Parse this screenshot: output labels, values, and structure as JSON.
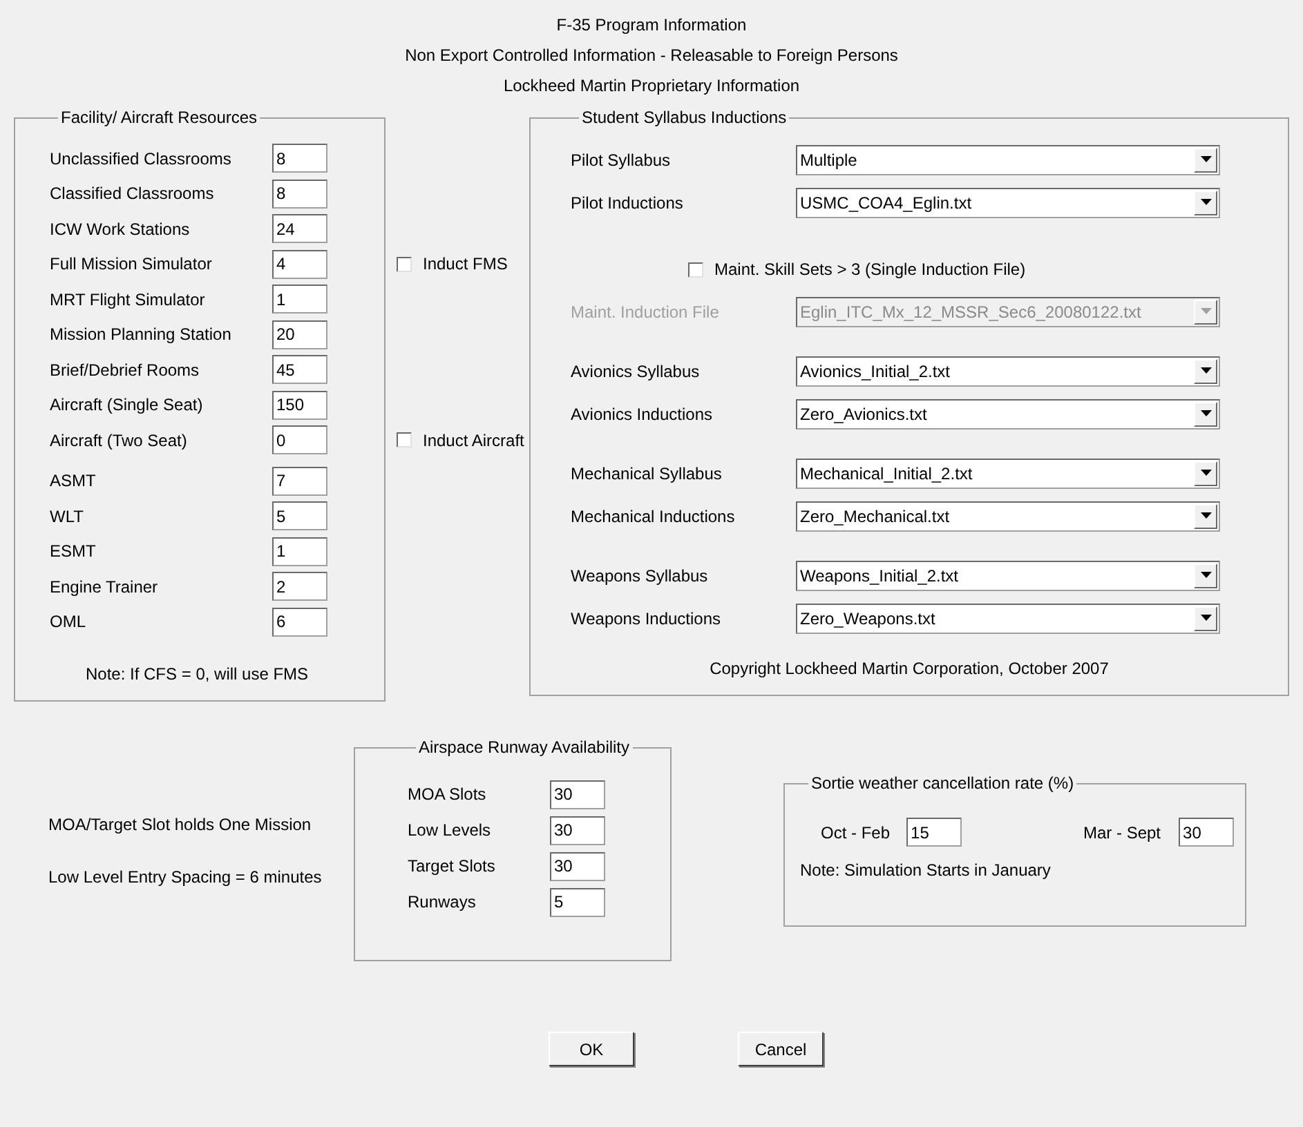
{
  "header": [
    "F-35 Program Information",
    "Non Export Controlled Information - Releasable to Foreign Persons",
    "Lockheed Martin Proprietary Information"
  ],
  "resources": {
    "title": "Facility/ Aircraft Resources",
    "groups": [
      [
        {
          "label": "Unclassified Classrooms",
          "value": "8"
        },
        {
          "label": "Classified Classrooms",
          "value": "8"
        },
        {
          "label": "ICW Work Stations",
          "value": "24"
        },
        {
          "label": "Full Mission Simulator",
          "value": "4",
          "induct": {
            "label": "Induct FMS",
            "checked": false
          }
        },
        {
          "label": "MRT Flight Simulator",
          "value": "1"
        },
        {
          "label": "Mission Planning Station",
          "value": "20"
        },
        {
          "label": "Brief/Debrief Rooms",
          "value": "45"
        },
        {
          "label": "Aircraft (Single Seat)",
          "value": "150"
        },
        {
          "label": "Aircraft (Two Seat)",
          "value": "0",
          "induct": {
            "label": "Induct Aircraft",
            "checked": false
          }
        }
      ],
      [
        {
          "label": "ASMT",
          "value": "7"
        },
        {
          "label": "WLT",
          "value": "5"
        },
        {
          "label": "ESMT",
          "value": "1"
        },
        {
          "label": "Engine Trainer",
          "value": "2"
        },
        {
          "label": "OML",
          "value": "6"
        }
      ]
    ],
    "note": "Note:  If CFS = 0, will use FMS"
  },
  "syllabus": {
    "title": "Student Syllabus  Inductions",
    "groups": [
      [
        {
          "kind": "dropdown",
          "label": "Pilot Syllabus",
          "value": "Multiple",
          "disabled": false
        },
        {
          "kind": "dropdown",
          "label": "Pilot Inductions",
          "value": "USMC_COA4_Eglin.txt",
          "disabled": false
        }
      ],
      [
        {
          "kind": "checkbox",
          "label": "Maint. Skill Sets > 3 (Single Induction File)",
          "checked": false
        },
        {
          "kind": "dropdown",
          "label": "Maint. Induction File",
          "value": "Eglin_ITC_Mx_12_MSSR_Sec6_20080122.txt",
          "disabled": true
        }
      ],
      [
        {
          "kind": "dropdown",
          "label": "Avionics Syllabus",
          "value": "Avionics_Initial_2.txt",
          "disabled": false
        },
        {
          "kind": "dropdown",
          "label": "Avionics Inductions",
          "value": "Zero_Avionics.txt",
          "disabled": false
        }
      ],
      [
        {
          "kind": "dropdown",
          "label": "Mechanical Syllabus",
          "value": "Mechanical_Initial_2.txt",
          "disabled": false
        },
        {
          "kind": "dropdown",
          "label": "Mechanical Inductions",
          "value": "Zero_Mechanical.txt",
          "disabled": false
        }
      ],
      [
        {
          "kind": "dropdown",
          "label": "Weapons Syllabus",
          "value": "Weapons_Initial_2.txt",
          "disabled": false
        },
        {
          "kind": "dropdown",
          "label": "Weapons Inductions",
          "value": "Zero_Weapons.txt",
          "disabled": false
        }
      ]
    ],
    "copyright": "Copyright Lockheed Martin Corporation, October 2007"
  },
  "notes": [
    "MOA/Target Slot holds One Mission",
    "Low Level Entry Spacing = 6 minutes"
  ],
  "airspace": {
    "title": "Airspace  Runway Availability",
    "fields": [
      {
        "label": "MOA Slots",
        "value": "30"
      },
      {
        "label": "Low Levels",
        "value": "30"
      },
      {
        "label": "Target Slots",
        "value": "30"
      },
      {
        "label": "Runways",
        "value": "5"
      }
    ]
  },
  "weather": {
    "title": "Sortie weather cancellation rate (%)",
    "fields": [
      {
        "label": "Oct - Feb",
        "value": "15"
      },
      {
        "label": "Mar - Sept",
        "value": "30"
      }
    ],
    "note": "Note:  Simulation Starts in January"
  },
  "buttons": [
    "OK",
    "Cancel"
  ]
}
